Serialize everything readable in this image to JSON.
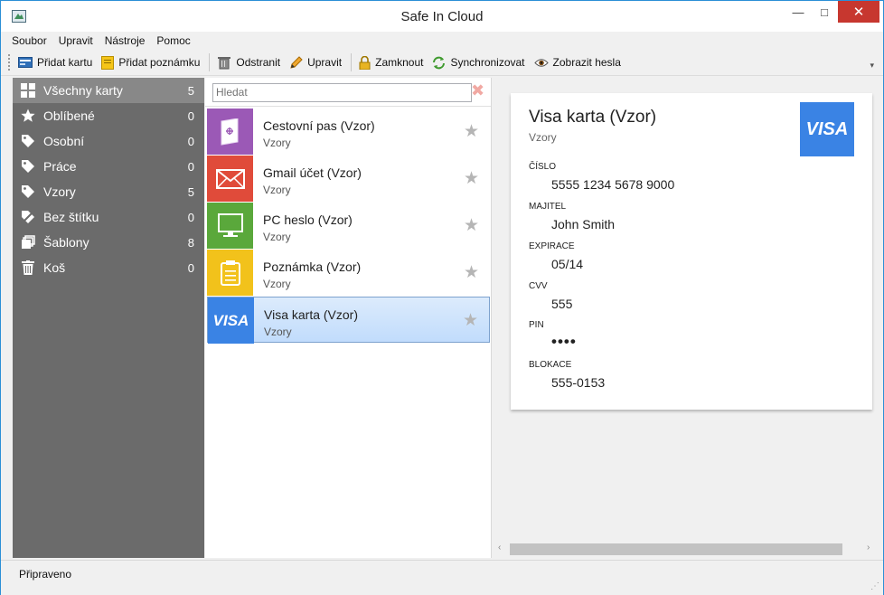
{
  "window": {
    "title": "Safe In Cloud",
    "min_glyph": "—",
    "max_glyph": "□",
    "close_glyph": "✕"
  },
  "menu": [
    "Soubor",
    "Upravit",
    "Nástroje",
    "Pomoc"
  ],
  "toolbar": {
    "add_card": "Přidat kartu",
    "add_note": "Přidat poznámku",
    "delete": "Odstranit",
    "edit": "Upravit",
    "lock": "Zamknout",
    "sync": "Synchronizovat",
    "show_passwords": "Zobrazit hesla",
    "overflow": "▾"
  },
  "sidebar": {
    "items": [
      {
        "label": "Všechny karty",
        "count": "5",
        "icon": "grid-icon",
        "selected": true
      },
      {
        "label": "Oblíbené",
        "count": "0",
        "icon": "star-icon"
      },
      {
        "label": "Osobní",
        "count": "0",
        "icon": "tag-icon"
      },
      {
        "label": "Práce",
        "count": "0",
        "icon": "tag-icon"
      },
      {
        "label": "Vzory",
        "count": "5",
        "icon": "tag-icon"
      },
      {
        "label": "Bez štítku",
        "count": "0",
        "icon": "untagged-icon"
      },
      {
        "label": "Šablony",
        "count": "8",
        "icon": "templates-icon"
      },
      {
        "label": "Koš",
        "count": "0",
        "icon": "trash-icon"
      }
    ]
  },
  "search": {
    "placeholder": "Hledat",
    "value": "",
    "clear_glyph": "✖"
  },
  "cards": [
    {
      "title": "Cestovní pas (Vzor)",
      "subtitle": "Vzory",
      "color": "#9b59b6",
      "icon": "passport-icon"
    },
    {
      "title": "Gmail účet (Vzor)",
      "subtitle": "Vzory",
      "color": "#e04b3a",
      "icon": "mail-icon"
    },
    {
      "title": "PC heslo (Vzor)",
      "subtitle": "Vzory",
      "color": "#5aa83b",
      "icon": "monitor-icon"
    },
    {
      "title": "Poznámka (Vzor)",
      "subtitle": "Vzory",
      "color": "#f2c21b",
      "icon": "note-icon"
    },
    {
      "title": "Visa karta (Vzor)",
      "subtitle": "Vzory",
      "color": "#3a83e4",
      "icon": "visa-icon",
      "tile_text": "VISA",
      "selected": true
    }
  ],
  "star_glyph": "★",
  "detail": {
    "title": "Visa karta (Vzor)",
    "subtitle": "Vzory",
    "logo": "VISA",
    "fields": [
      {
        "label": "ČÍSLO",
        "value": "5555 1234 5678 9000"
      },
      {
        "label": "MAJITEL",
        "value": "John Smith"
      },
      {
        "label": "EXPIRACE",
        "value": "05/14"
      },
      {
        "label": "CVV",
        "value": "555"
      },
      {
        "label": "PIN",
        "value": "••••"
      },
      {
        "label": "BLOKACE",
        "value": "555-0153"
      }
    ]
  },
  "scroll_arrows": {
    "left": "‹",
    "right": "›"
  },
  "status": {
    "text": "Připraveno",
    "grip": "⋰"
  },
  "colors": {
    "sidebar": "#6b6b6b",
    "sidebar_selected": "#888888",
    "accent": "#3a83e4",
    "close": "#c7372f"
  }
}
